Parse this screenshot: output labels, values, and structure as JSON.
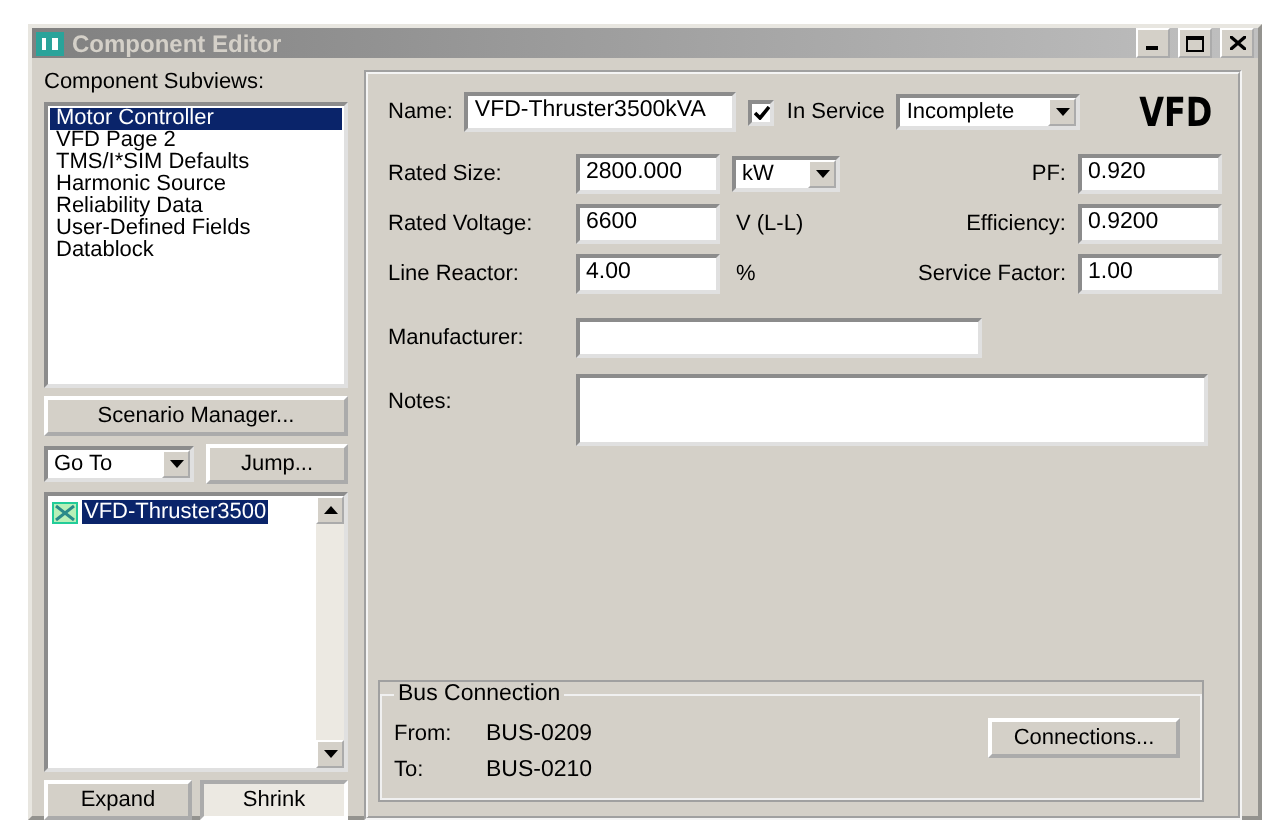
{
  "window": {
    "title": "Component Editor"
  },
  "subviews": {
    "label": "Component Subviews:",
    "items": [
      {
        "label": "Motor Controller",
        "selected": true
      },
      {
        "label": "VFD Page 2",
        "selected": false
      },
      {
        "label": "TMS/I*SIM Defaults",
        "selected": false
      },
      {
        "label": "Harmonic Source",
        "selected": false
      },
      {
        "label": "Reliability Data",
        "selected": false
      },
      {
        "label": "User-Defined Fields",
        "selected": false
      },
      {
        "label": "Datablock",
        "selected": false
      }
    ]
  },
  "scenario_button": "Scenario Manager...",
  "goto": {
    "value": "Go To"
  },
  "jump_button": "Jump...",
  "tree": {
    "items": [
      {
        "label": "VFD-Thruster3500",
        "selected": true
      }
    ]
  },
  "view_tabs": [
    {
      "label": "Expand",
      "selected": false
    },
    {
      "label": "Shrink",
      "selected": true
    }
  ],
  "name": {
    "label": "Name:",
    "value": "VFD-Thruster3500kVA"
  },
  "in_service": {
    "label": "In Service",
    "checked": true
  },
  "status": {
    "value": "Incomplete"
  },
  "type_badge": "VFD",
  "rows": [
    {
      "label": "Rated Size:",
      "value": "2800.000",
      "unit": {
        "kind": "dropdown",
        "value": "kW"
      },
      "right_label": "PF:",
      "right_value": "0.920"
    },
    {
      "label": "Rated Voltage:",
      "value": "6600",
      "unit": {
        "kind": "text",
        "value": "V (L-L)"
      },
      "right_label": "Efficiency:",
      "right_value": "0.9200"
    },
    {
      "label": "Line Reactor:",
      "value": "4.00",
      "unit": {
        "kind": "text",
        "value": "%"
      },
      "right_label": "Service Factor:",
      "right_value": "1.00"
    }
  ],
  "manufacturer": {
    "label": "Manufacturer:"
  },
  "notes": {
    "label": "Notes:"
  },
  "bus_connection": {
    "title": "Bus Connection",
    "from_label": "From:",
    "from": "BUS-0209",
    "to_label": "To:",
    "to": "BUS-0210",
    "button": "Connections..."
  }
}
